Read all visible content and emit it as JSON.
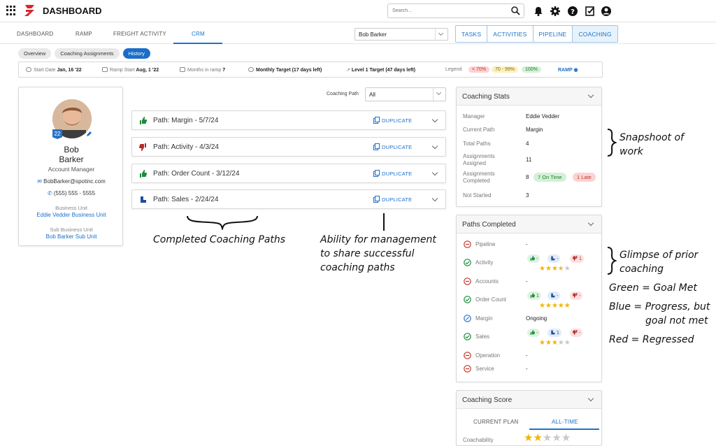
{
  "app": {
    "title": "DASHBOARD",
    "search_placeholder": "Search..."
  },
  "top_icons": [
    "bell-icon",
    "gear-icon",
    "help-icon",
    "task-check-icon",
    "account-icon"
  ],
  "nav_tabs": [
    {
      "label": "DASHBOARD",
      "active": false
    },
    {
      "label": "RAMP",
      "active": false
    },
    {
      "label": "FREIGHT ACTIVITY",
      "active": false
    },
    {
      "label": "CRM",
      "active": true
    }
  ],
  "user_select": {
    "value": "Bob Barker"
  },
  "view_buttons": [
    "TASKS",
    "ACTIVITIES",
    "PIPELINE",
    "COACHING"
  ],
  "sub_tabs": [
    {
      "label": "Overview",
      "active": false
    },
    {
      "label": "Coaching Assignments",
      "active": false
    },
    {
      "label": "History",
      "active": true
    }
  ],
  "info_bar": {
    "start_date_label": "Start Date",
    "start_date": "Jan, 16 '22",
    "ramp_start_label": "Ramp Start",
    "ramp_start": "Aug, 1 '22",
    "months_label": "Months in ramp",
    "months": "7",
    "monthly_target": "Monthly Target (17 days left)",
    "level_target": "Level 1 Target (47 days left)",
    "legend_label": "Legend",
    "legend": [
      {
        "label": "< 70%",
        "bg": "#fbd3d3",
        "fg": "#c0392b"
      },
      {
        "label": "70 - 99%",
        "bg": "#fbf0c0",
        "fg": "#8a6d00"
      },
      {
        "label": "100%",
        "bg": "#d4f1d6",
        "fg": "#1e7b34"
      }
    ],
    "ramp_link": "RAMP"
  },
  "profile": {
    "level": "22",
    "first_name": "Bob",
    "last_name": "Barker",
    "role": "Account Manager",
    "email": "BobBarker@spotinc.com",
    "phone": "(555) 555 - 5555",
    "business_unit_label": "Business Unit",
    "business_unit": "Eddie Vedder Business Unit",
    "sub_business_unit_label": "Sub Business Unit",
    "sub_business_unit": "Bob Barker Sub Unit"
  },
  "coaching_path_filter": {
    "label": "Coaching Path",
    "value": "All"
  },
  "paths": [
    {
      "title": "Path: Margin - 5/7/24",
      "status": "up",
      "duplicate": "DUPLICATE"
    },
    {
      "title": "Path: Activity - 4/3/24",
      "status": "down",
      "duplicate": "DUPLICATE"
    },
    {
      "title": "Path: Order Count - 3/12/24",
      "status": "up",
      "duplicate": "DUPLICATE"
    },
    {
      "title": "Path: Sales - 2/24/24",
      "status": "progress",
      "duplicate": "DUPLICATE"
    }
  ],
  "annotations": {
    "completed_paths": "Completed Coaching Paths",
    "share_1": "Ability for management",
    "share_2": "to share successful",
    "share_3": "coaching paths",
    "snapshot_1": "Snapshoot of",
    "snapshot_2": "work",
    "glimpse_1": "Glimpse of prior",
    "glimpse_2": "coaching",
    "green": "Green = Goal Met",
    "blue_1": "Blue = Progress, but",
    "blue_2": "goal not met",
    "red": "Red = Regressed"
  },
  "coaching_stats": {
    "title": "Coaching Stats",
    "rows": [
      {
        "label": "Manager",
        "value": "Eddie Vedder"
      },
      {
        "label": "Current Path",
        "value": "Margin"
      },
      {
        "label": "Total Paths",
        "value": "4"
      },
      {
        "label": "Assignments Assigned",
        "value": "11"
      },
      {
        "label": "Assignments Completed",
        "value": "8"
      },
      {
        "label": "Not Started",
        "value": "3"
      }
    ],
    "on_time": "7 On Time",
    "late": "1 Late"
  },
  "paths_completed": {
    "title": "Paths Completed",
    "rows": [
      {
        "name": "Pipeline",
        "status": "minus",
        "value": "-"
      },
      {
        "name": "Activity",
        "status": "check",
        "up": "-",
        "mid": "-",
        "down": "1",
        "rating": 3.5
      },
      {
        "name": "Accounts",
        "status": "minus",
        "value": "-"
      },
      {
        "name": "Order Count",
        "status": "check",
        "up": "1",
        "mid": "-",
        "down": "-",
        "rating": 5
      },
      {
        "name": "Margin",
        "status": "progress",
        "value": "Ongoing"
      },
      {
        "name": "Sales",
        "status": "check",
        "up": "-",
        "mid": "1",
        "down": "-",
        "rating": 3
      },
      {
        "name": "Operation",
        "status": "minus",
        "value": "-"
      },
      {
        "name": "Service",
        "status": "minus",
        "value": "-"
      }
    ]
  },
  "coaching_score": {
    "title": "Coaching Score",
    "tabs": [
      {
        "label": "CURRENT PLAN",
        "active": false
      },
      {
        "label": "ALL-TIME",
        "active": true
      }
    ],
    "coachability_label": "Coachability",
    "coachability_rating": 2
  },
  "colors": {
    "accent": "#1a73c9",
    "green": "#1e8b3a",
    "red": "#c0392b",
    "blue": "#1a4fa0"
  }
}
